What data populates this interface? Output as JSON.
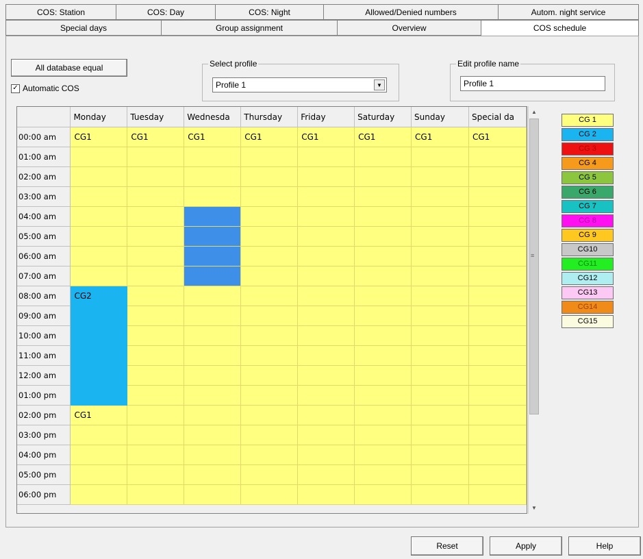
{
  "tabs_row1": [
    "COS: Station",
    "COS: Day",
    "COS: Night",
    "Allowed/Denied numbers",
    "Autom. night service"
  ],
  "tabs_row2": [
    "Special days",
    "Group assignment",
    "Overview",
    "COS schedule"
  ],
  "active_tab": "COS schedule",
  "controls": {
    "all_db_equal": "All database equal",
    "automatic_cos_label": "Automatic COS",
    "automatic_cos_checked": true,
    "select_profile_label": "Select profile",
    "select_profile_value": "Profile 1",
    "edit_profile_label": "Edit profile name",
    "edit_profile_value": "Profile 1"
  },
  "grid": {
    "columns": [
      "",
      "Monday",
      "Tuesday",
      "Wednesda",
      "Thursday",
      "Friday",
      "Saturday",
      "Sunday",
      "Special da"
    ],
    "rows": [
      {
        "time": "00:00 am",
        "cells": [
          "CG1",
          "CG1",
          "CG1",
          "CG1",
          "CG1",
          "CG1",
          "CG1",
          "CG1"
        ]
      },
      {
        "time": "01:00 am",
        "cells": [
          "",
          "",
          "",
          "",
          "",
          "",
          "",
          ""
        ]
      },
      {
        "time": "02:00 am",
        "cells": [
          "",
          "",
          "",
          "",
          "",
          "",
          "",
          ""
        ]
      },
      {
        "time": "03:00 am",
        "cells": [
          "",
          "",
          "",
          "",
          "",
          "",
          "",
          ""
        ]
      },
      {
        "time": "04:00 am",
        "cells": [
          "",
          "",
          "",
          "",
          "",
          "",
          "",
          ""
        ]
      },
      {
        "time": "05:00 am",
        "cells": [
          "",
          "",
          "",
          "",
          "",
          "",
          "",
          ""
        ]
      },
      {
        "time": "06:00 am",
        "cells": [
          "",
          "",
          "",
          "",
          "",
          "",
          "",
          ""
        ]
      },
      {
        "time": "07:00 am",
        "cells": [
          "",
          "",
          "",
          "",
          "",
          "",
          "",
          ""
        ]
      },
      {
        "time": "08:00 am",
        "cells": [
          "CG2",
          "",
          "",
          "",
          "",
          "",
          "",
          ""
        ]
      },
      {
        "time": "09:00 am",
        "cells": [
          "",
          "",
          "",
          "",
          "",
          "",
          "",
          ""
        ]
      },
      {
        "time": "10:00 am",
        "cells": [
          "",
          "",
          "",
          "",
          "",
          "",
          "",
          ""
        ]
      },
      {
        "time": "11:00 am",
        "cells": [
          "",
          "",
          "",
          "",
          "",
          "",
          "",
          ""
        ]
      },
      {
        "time": "12:00 am",
        "cells": [
          "",
          "",
          "",
          "",
          "",
          "",
          "",
          ""
        ]
      },
      {
        "time": "01:00 pm",
        "cells": [
          "",
          "",
          "",
          "",
          "",
          "",
          "",
          ""
        ]
      },
      {
        "time": "02:00 pm",
        "cells": [
          "CG1",
          "",
          "",
          "",
          "",
          "",
          "",
          ""
        ]
      },
      {
        "time": "03:00 pm",
        "cells": [
          "",
          "",
          "",
          "",
          "",
          "",
          "",
          ""
        ]
      },
      {
        "time": "04:00 pm",
        "cells": [
          "",
          "",
          "",
          "",
          "",
          "",
          "",
          ""
        ]
      },
      {
        "time": "05:00 pm",
        "cells": [
          "",
          "",
          "",
          "",
          "",
          "",
          "",
          ""
        ]
      },
      {
        "time": "06:00 pm",
        "cells": [
          "",
          "",
          "",
          "",
          "",
          "",
          "",
          ""
        ]
      }
    ]
  },
  "colors": {
    "cell_default": "#ffff80",
    "cg2_selection": "#1ab5f0",
    "wednesday_selection": "#3d8fe8"
  },
  "legend": [
    {
      "label": "CG 1",
      "color": "#ffff80",
      "text": "#000000"
    },
    {
      "label": "CG 2",
      "color": "#1ab5f0",
      "text": "#000000"
    },
    {
      "label": "CG 3",
      "color": "#ee1111",
      "text": "#b00000"
    },
    {
      "label": "CG 4",
      "color": "#f59a1a",
      "text": "#000000"
    },
    {
      "label": "CG 5",
      "color": "#8cc63f",
      "text": "#000000"
    },
    {
      "label": "CG 6",
      "color": "#3aa86b",
      "text": "#000000"
    },
    {
      "label": "CG 7",
      "color": "#19c2c2",
      "text": "#000000"
    },
    {
      "label": "CG 8",
      "color": "#ff10f0",
      "text": "#b000a8"
    },
    {
      "label": "CG 9",
      "color": "#ffc820",
      "text": "#000000"
    },
    {
      "label": "CG10",
      "color": "#c8c8c8",
      "text": "#000000"
    },
    {
      "label": "CG11",
      "color": "#22ee22",
      "text": "#008800"
    },
    {
      "label": "CG12",
      "color": "#aeeef0",
      "text": "#000000"
    },
    {
      "label": "CG13",
      "color": "#fcc8f4",
      "text": "#000000"
    },
    {
      "label": "CG14",
      "color": "#f08a18",
      "text": "#a04000"
    },
    {
      "label": "CG15",
      "color": "#fbfbe0",
      "text": "#000000"
    }
  ],
  "buttons": {
    "reset": "Reset",
    "apply": "Apply",
    "help": "Help"
  }
}
